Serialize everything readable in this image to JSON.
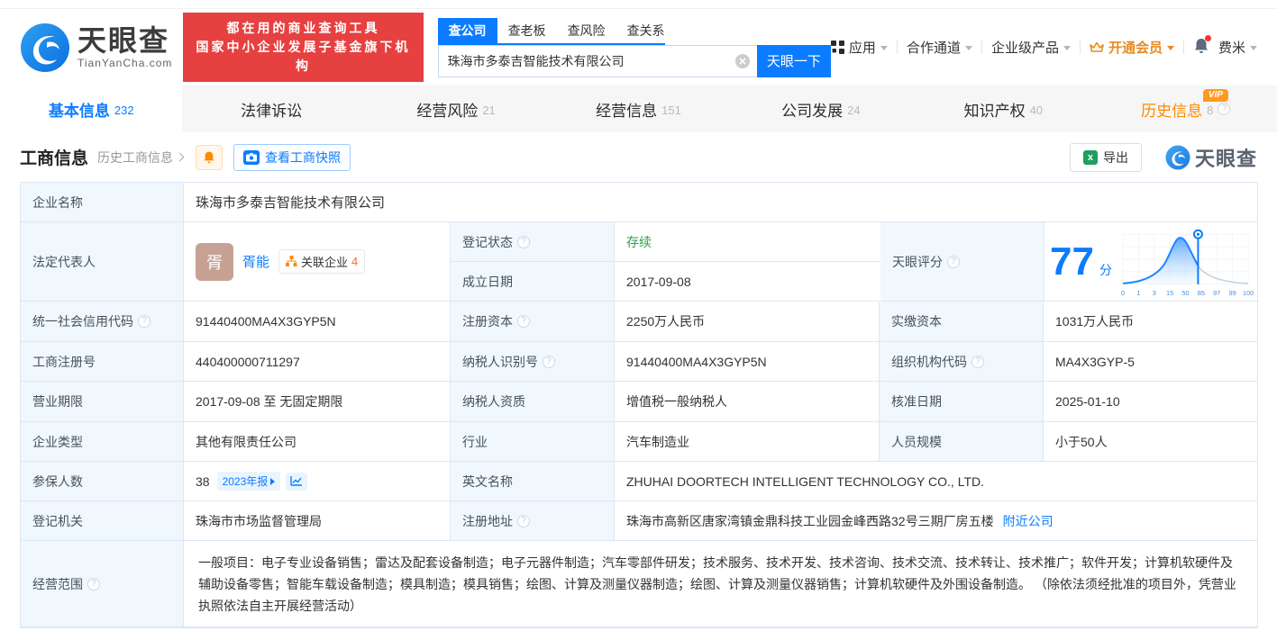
{
  "brand": {
    "name": "天眼查",
    "domain": "TianYanCha.com",
    "slogan_line1": "都在用的商业查询工具",
    "slogan_line2": "国家中小企业发展子基金旗下机构",
    "watermark": "天眼查"
  },
  "search": {
    "tabs": [
      {
        "label": "查公司"
      },
      {
        "label": "查老板"
      },
      {
        "label": "查风险"
      },
      {
        "label": "查关系"
      }
    ],
    "value": "珠海市多泰吉智能技术有限公司",
    "button": "天眼一下"
  },
  "top_menu": {
    "apps": "应用",
    "partner": "合作通道",
    "enterprise": "企业级产品",
    "vip": "开通会员",
    "user": "费米"
  },
  "nav_tabs": [
    {
      "label": "基本信息",
      "count": "232"
    },
    {
      "label": "法律诉讼",
      "count": ""
    },
    {
      "label": "经营风险",
      "count": "21"
    },
    {
      "label": "经营信息",
      "count": "151"
    },
    {
      "label": "公司发展",
      "count": "24"
    },
    {
      "label": "知识产权",
      "count": "40"
    },
    {
      "label": "历史信息",
      "count": "8",
      "badge": "VIP"
    }
  ],
  "section": {
    "title": "工商信息",
    "history_link": "历史工商信息",
    "snapshot_button": "查看工商快照",
    "export_button": "导出"
  },
  "fields": {
    "company_name": {
      "label": "企业名称",
      "value": "珠海市多泰吉智能技术有限公司"
    },
    "legal_rep": {
      "label": "法定代表人",
      "avatar_char": "胥",
      "name": "胥能",
      "related_label": "关联企业",
      "related_count": "4"
    },
    "reg_status": {
      "label": "登记状态",
      "value": "存续"
    },
    "establish_date": {
      "label": "成立日期",
      "value": "2017-09-08"
    },
    "score": {
      "label": "天眼评分",
      "value": "77",
      "unit": "分"
    },
    "uscc": {
      "label": "统一社会信用代码",
      "value": "91440400MA4X3GYP5N"
    },
    "reg_capital": {
      "label": "注册资本",
      "value": "2250万人民币"
    },
    "paid_capital": {
      "label": "实缴资本",
      "value": "1031万人民币"
    },
    "reg_number": {
      "label": "工商注册号",
      "value": "440400000711297"
    },
    "taxpayer_id": {
      "label": "纳税人识别号",
      "value": "91440400MA4X3GYP5N"
    },
    "org_code": {
      "label": "组织机构代码",
      "value": "MA4X3GYP-5"
    },
    "business_term": {
      "label": "营业期限",
      "value": "2017-09-08 至 无固定期限"
    },
    "taxpayer_quality": {
      "label": "纳税人资质",
      "value": "增值税一般纳税人"
    },
    "approval_date": {
      "label": "核准日期",
      "value": "2025-01-10"
    },
    "company_type": {
      "label": "企业类型",
      "value": "其他有限责任公司"
    },
    "industry": {
      "label": "行业",
      "value": "汽车制造业"
    },
    "staff_size": {
      "label": "人员规模",
      "value": "小于50人"
    },
    "insured": {
      "label": "参保人数",
      "value": "38",
      "badge": "2023年报"
    },
    "english_name": {
      "label": "英文名称",
      "value": "ZHUHAI DOORTECH INTELLIGENT TECHNOLOGY CO., LTD."
    },
    "reg_authority": {
      "label": "登记机关",
      "value": "珠海市市场监督管理局"
    },
    "reg_address": {
      "label": "注册地址",
      "value": "珠海市高新区唐家湾镇金鼎科技工业园金峰西路32号三期厂房五楼",
      "link": "附近公司"
    },
    "business_scope": {
      "label": "经营范围",
      "value": "一般项目：电子专业设备销售；雷达及配套设备制造；电子元器件制造；汽车零部件研发；技术服务、技术开发、技术咨询、技术交流、技术转让、技术推广；软件开发；计算机软硬件及辅助设备零售；智能车载设备制造；模具制造；模具销售；绘图、计算及测量仪器制造；绘图、计算及测量仪器销售；计算机软硬件及外围设备制造。 （除依法须经批准的项目外，凭营业执照依法自主开展经营活动）"
    }
  },
  "score_chart": {
    "type": "area",
    "score": 77,
    "ticks": [
      "0",
      "1",
      "3",
      "15",
      "50",
      "85",
      "97",
      "99",
      "100"
    ],
    "accent_color": "#0b7cff"
  },
  "colors": {
    "accent": "#0b7cff",
    "orange": "#ff8a00",
    "green": "#2ba245",
    "banner_red": "#e74040",
    "label_bg": "#f0f7fd",
    "table_border": "#dce8f5"
  }
}
